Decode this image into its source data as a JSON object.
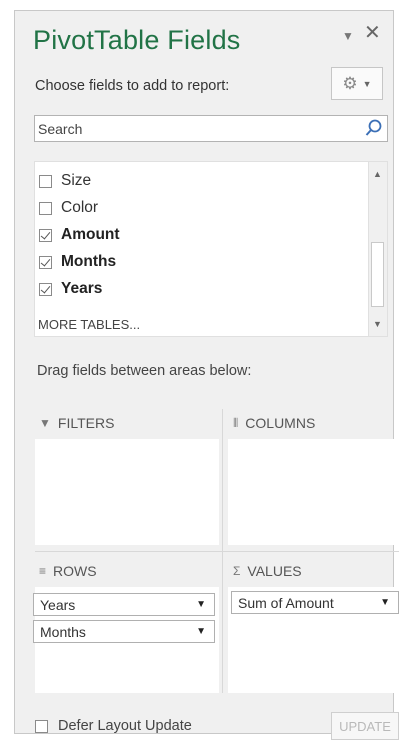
{
  "pane": {
    "title": "PivotTable Fields",
    "title_dropdown_icon": "chevron-down-icon",
    "close_icon": "close-icon",
    "choose_label": "Choose fields to add to report:",
    "tools_icon": "gear-icon"
  },
  "search": {
    "value": "Search",
    "icon": "search-icon"
  },
  "fields": [
    {
      "label": "Size",
      "checked": false
    },
    {
      "label": "Color",
      "checked": false
    },
    {
      "label": "Amount",
      "checked": true
    },
    {
      "label": "Months",
      "checked": true
    },
    {
      "label": "Years",
      "checked": true
    }
  ],
  "more_tables": "MORE TABLES...",
  "drag_label": "Drag fields between areas below:",
  "areas": {
    "filters": {
      "label": "FILTERS",
      "icon": "filter-icon",
      "items": []
    },
    "columns": {
      "label": "COLUMNS",
      "icon": "columns-icon",
      "items": []
    },
    "rows": {
      "label": "ROWS",
      "icon": "rows-icon",
      "items": [
        "Years",
        "Months"
      ]
    },
    "values": {
      "label": "VALUES",
      "icon": "sigma-icon",
      "items": [
        "Sum of Amount"
      ]
    }
  },
  "footer": {
    "defer_label": "Defer Layout Update",
    "defer_checked": false,
    "update_label": "UPDATE"
  },
  "colors": {
    "title_green": "#217346",
    "pane_bg": "#f0f0f0"
  }
}
